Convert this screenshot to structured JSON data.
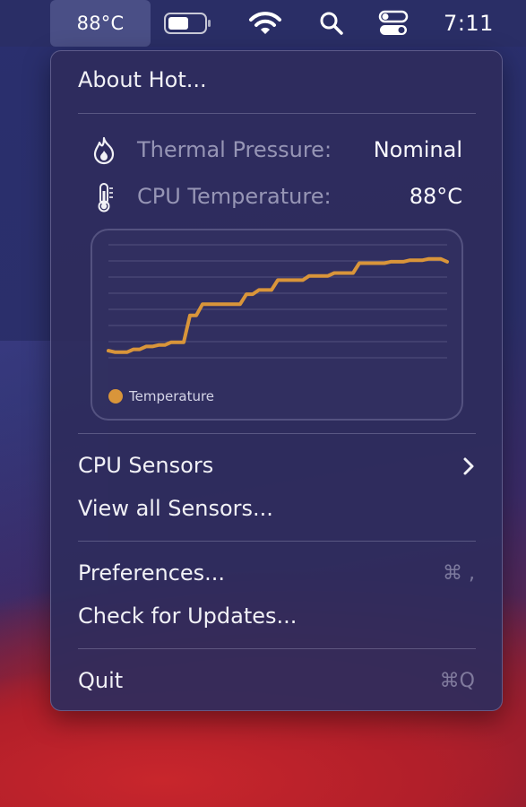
{
  "menubar": {
    "temperature": "88°C",
    "clock": "7:11"
  },
  "menu": {
    "about_label": "About Hot...",
    "thermal_pressure_label": "Thermal Pressure:",
    "thermal_pressure_value": "Nominal",
    "cpu_temp_label": "CPU Temperature:",
    "cpu_temp_value": "88°C",
    "cpu_sensors_label": "CPU Sensors",
    "view_all_label": "View all Sensors...",
    "preferences_label": "Preferences...",
    "preferences_shortcut": "⌘ ,",
    "updates_label": "Check for Updates...",
    "quit_label": "Quit",
    "quit_shortcut": "⌘Q"
  },
  "icons": {
    "flame": "flame-icon",
    "thermometer": "thermometer-icon",
    "battery": "battery-icon",
    "wifi": "wifi-icon",
    "search": "search-icon",
    "control_center": "control-center-icon",
    "chevron": "chevron-right-icon"
  },
  "colors": {
    "series": "#d9953a"
  },
  "chart_data": {
    "type": "line",
    "grid": true,
    "legend": "bottom-left",
    "series": [
      {
        "name": "Temperature",
        "values": [
          5,
          4,
          4,
          4,
          6,
          6,
          8,
          8,
          9,
          9,
          11,
          11,
          11,
          30,
          30,
          38,
          38,
          38,
          38,
          38,
          38,
          38,
          45,
          45,
          48,
          48,
          48,
          55,
          55,
          55,
          55,
          55,
          58,
          58,
          58,
          58,
          60,
          60,
          60,
          60,
          67,
          67,
          67,
          67,
          67,
          68,
          68,
          68,
          69,
          69,
          69,
          70,
          70,
          70,
          68
        ]
      }
    ],
    "ylim": [
      0,
      80
    ]
  }
}
